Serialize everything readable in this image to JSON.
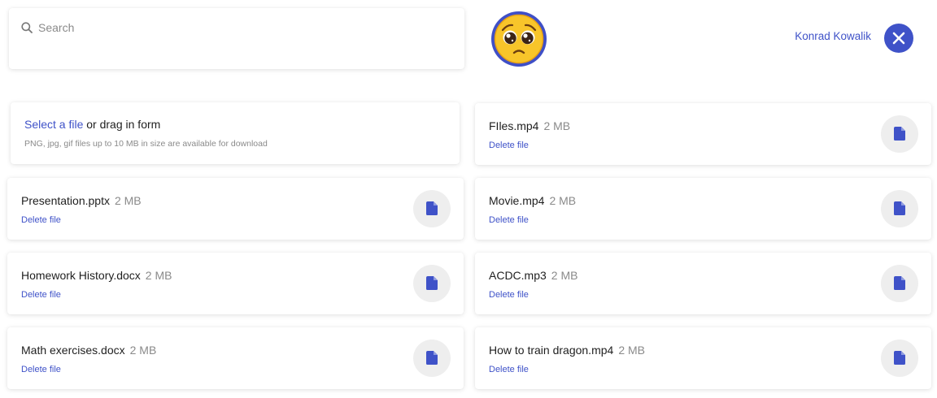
{
  "search": {
    "placeholder": "Search"
  },
  "user": {
    "name": "Konrad Kowalik"
  },
  "upload": {
    "link_text": "Select a file",
    "rest_text": " or drag in form",
    "hint": "PNG, jpg, gif files up to 10 MB in size are available for download"
  },
  "files_left": [
    {
      "name": "Presentation.pptx",
      "size": "2 MB",
      "action": "Delete file"
    },
    {
      "name": "Homework History.docx",
      "size": "2 MB",
      "action": "Delete file"
    },
    {
      "name": "Math exercises.docx",
      "size": "2 MB",
      "action": "Delete file"
    }
  ],
  "files_right": [
    {
      "name": "FIles.mp4",
      "size": "2 MB",
      "action": "Delete file"
    },
    {
      "name": "Movie.mp4",
      "size": "2 MB",
      "action": "Delete file"
    },
    {
      "name": "ACDC.mp3",
      "size": "2 MB",
      "action": "Delete file"
    },
    {
      "name": "How to train dragon.mp4",
      "size": "2 MB",
      "action": "Delete file"
    }
  ],
  "colors": {
    "accent": "#3f52c8",
    "icon_bg": "#eeeeee"
  },
  "icons": {
    "search": "search-icon",
    "close": "close-icon",
    "file": "file-icon",
    "avatar": "pleading-face-emoji"
  }
}
